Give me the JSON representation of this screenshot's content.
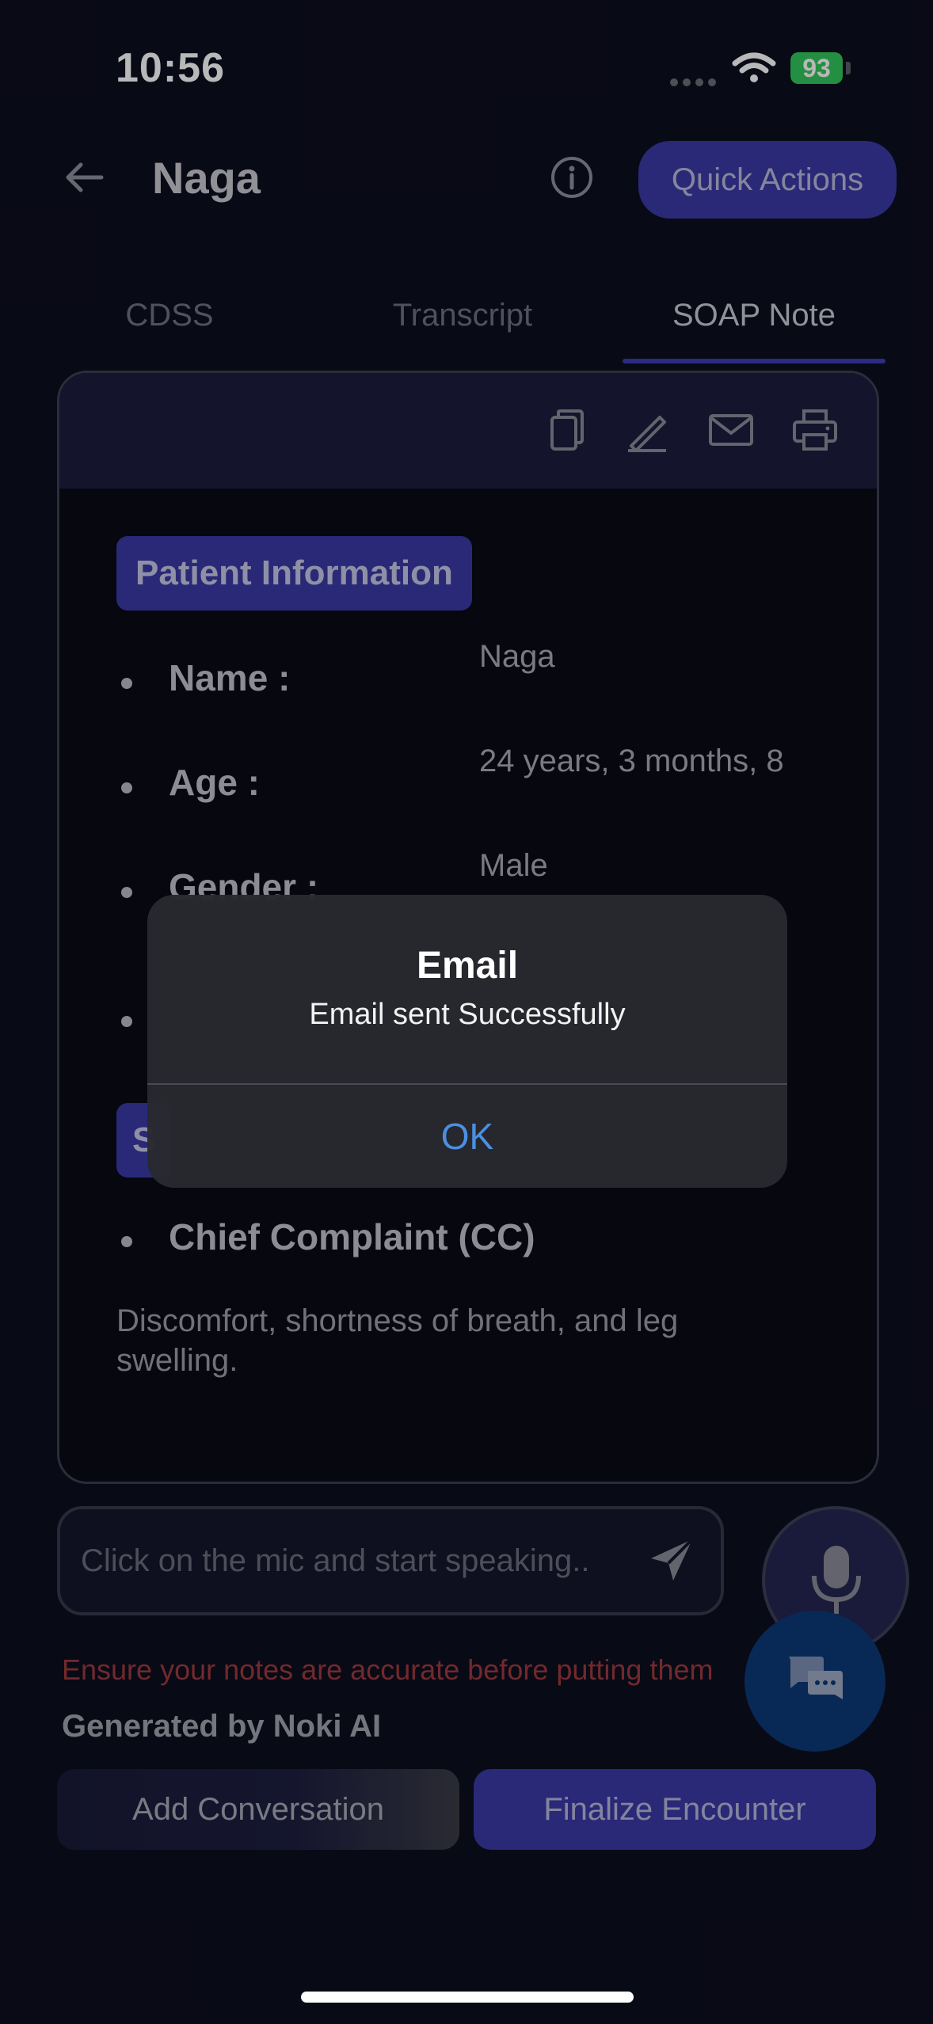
{
  "status_bar": {
    "time": "10:56",
    "battery": "93"
  },
  "header": {
    "title": "Naga",
    "quick_actions_label": "Quick Actions"
  },
  "tabs": [
    {
      "label": "CDSS",
      "active": false
    },
    {
      "label": "Transcript",
      "active": false
    },
    {
      "label": "SOAP Note",
      "active": true
    }
  ],
  "soap_note": {
    "patient_info_heading": "Patient Information",
    "fields": [
      {
        "label": "Name :",
        "value": "Naga"
      },
      {
        "label": "Age :",
        "value": "24 years, 3 months, 8"
      },
      {
        "label": "Gender :",
        "value": "Male"
      }
    ],
    "subjective_heading_visible": "S",
    "chief_complaint_label": "Chief Complaint (CC)",
    "chief_complaint_text": "Discomfort, shortness of breath, and leg swelling."
  },
  "input": {
    "placeholder": "Click on the mic and start speaking.."
  },
  "warning_text": "Ensure your notes are accurate before putting them",
  "generated_by": "Generated by Noki AI",
  "buttons": {
    "add_conversation": "Add Conversation",
    "finalize_encounter": "Finalize Encounter"
  },
  "alert": {
    "title": "Email",
    "message": "Email sent Successfully",
    "ok_label": "OK"
  },
  "colors": {
    "accent": "#3b3aa6",
    "background": "#0c0e1f",
    "alert_link": "#4c8fe3",
    "warning": "#9e3a3e",
    "battery": "#32c75c"
  }
}
